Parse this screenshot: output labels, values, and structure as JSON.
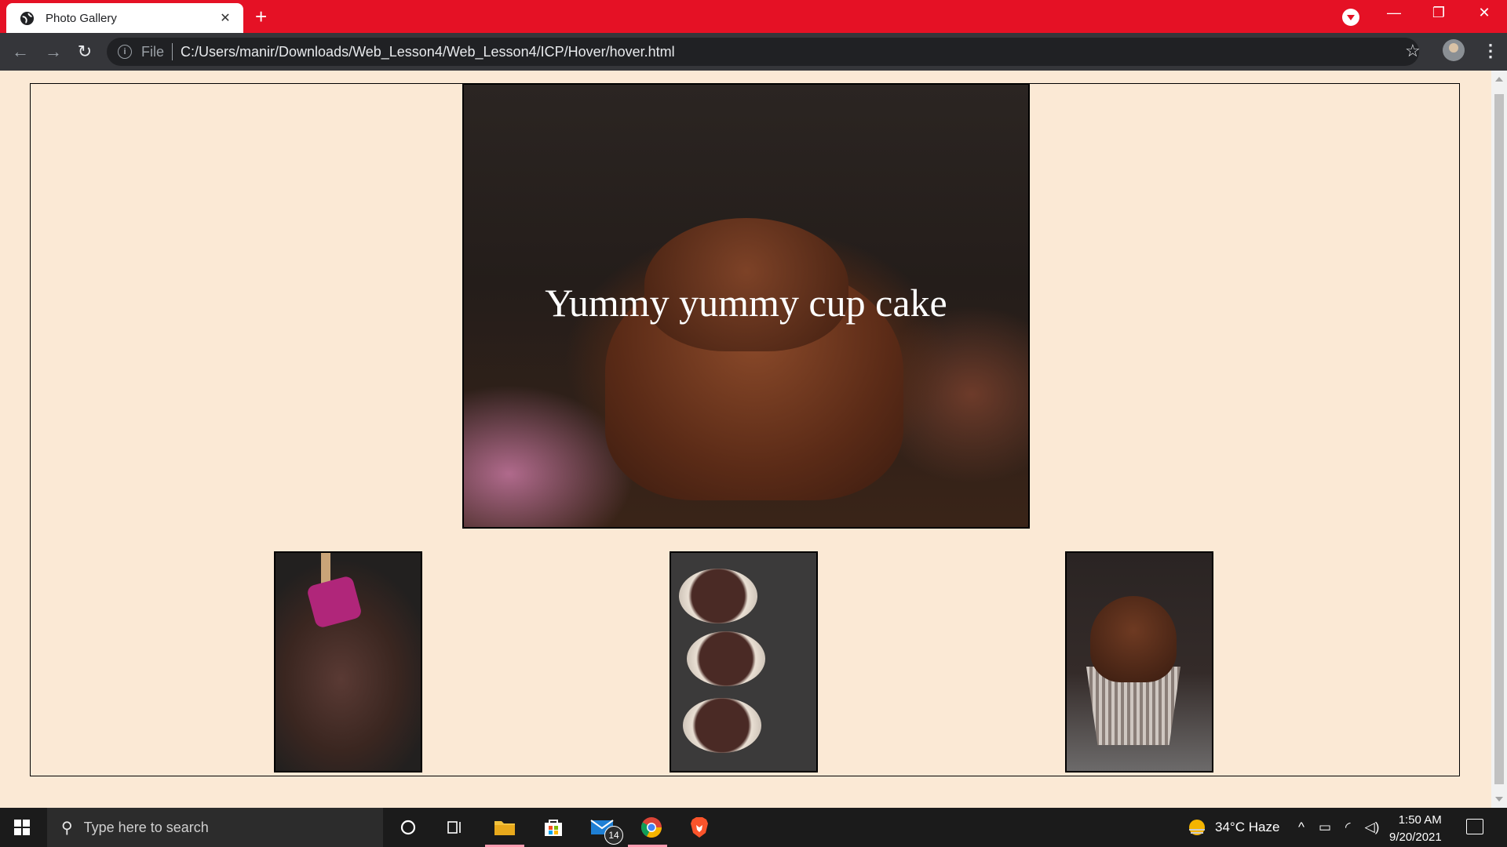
{
  "browser": {
    "tab_title": "Photo Gallery",
    "tab_close": "✕",
    "new_tab": "+",
    "back": "←",
    "forward": "→",
    "reload": "↻",
    "scheme_label": "File",
    "url": "C:/Users/manir/Downloads/Web_Lesson4/Web_Lesson4/ICP/Hover/hover.html",
    "bookmark": "☆",
    "menu": "⋮",
    "window_buttons": {
      "minimize": "—",
      "restore": "❐",
      "close": "✕"
    },
    "accent_color": "#e51125"
  },
  "page": {
    "hero_caption": "Yummy yummy cup cake",
    "background_color": "#fbe9d5"
  },
  "taskbar": {
    "search_placeholder": "Type here to search",
    "weather": "34°C  Haze",
    "time": "1:50 AM",
    "date": "9/20/2021",
    "mail_badge": "14",
    "icons": [
      "windows-start-icon",
      "search-icon",
      "cortana-icon",
      "task-view-icon",
      "file-explorer-icon",
      "store-icon",
      "mail-icon",
      "chrome-icon",
      "brave-icon"
    ]
  }
}
